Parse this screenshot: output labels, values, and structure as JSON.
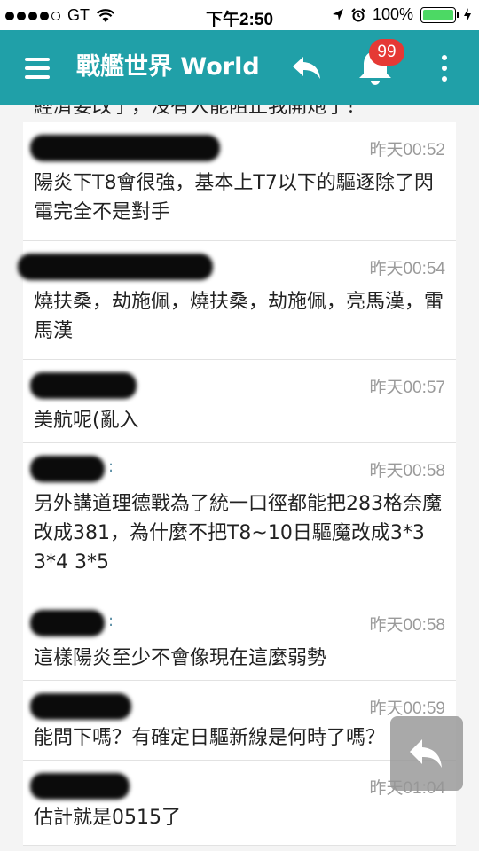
{
  "status_bar": {
    "carrier": "GT",
    "time": "下午2:50",
    "battery": "100%"
  },
  "app_bar": {
    "title": "戰艦世界 World",
    "notification_count": "99"
  },
  "cutoff_text": "經濟要改了，沒有人能阻止我開炮了！",
  "comments": [
    {
      "time": "昨天00:52",
      "text": "陽炎下T8會很強，基本上T7以下的驅逐除了閃電完全不是對手"
    },
    {
      "time": "昨天00:54",
      "text": "燒扶桑，劫施佩，燒扶桑，劫施佩，亮馬漢，雷馬漢"
    },
    {
      "time": "昨天00:57",
      "text": "美航呢(亂入"
    },
    {
      "time": "昨天00:58",
      "text": "另外講道理德戰為了統一口徑都能把283格奈魔改成381，為什麼不把T8~10日驅魔改成3*3 3*4 3*5"
    },
    {
      "time": "昨天00:58",
      "text": "這樣陽炎至少不會像現在這麼弱勢"
    },
    {
      "time": "昨天00:59",
      "text": "能問下嗎？有確定日驅新線是何時了嗎？"
    },
    {
      "time": "昨天01:04",
      "text": "估計就是0515了"
    }
  ],
  "colors": {
    "app_bar": "#20a0a8",
    "badge": "#e53935",
    "battery_fill": "#4cd964"
  }
}
